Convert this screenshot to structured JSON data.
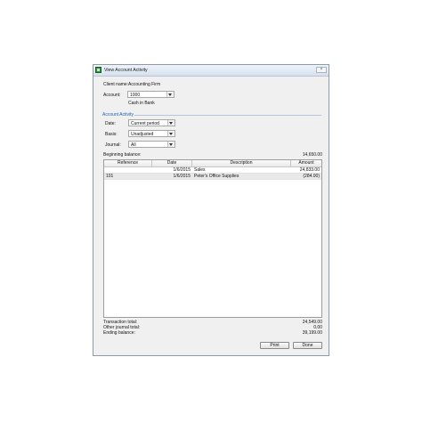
{
  "window": {
    "title": "View Account Activity",
    "close_glyph": "×"
  },
  "client": {
    "label": "Client name:",
    "value": "Accounting Firm"
  },
  "account": {
    "label": "Account:",
    "value": "1000",
    "name": "Cash in Bank"
  },
  "activity": {
    "section_title": "Account Activity",
    "date_label": "Date:",
    "date_value": "Current period",
    "basis_label": "Basis:",
    "basis_value": "Unadjusted",
    "journal_label": "Journal:",
    "journal_value": "All"
  },
  "beginning_balance": {
    "label": "Beginning balance:",
    "value": "14,650.00"
  },
  "table": {
    "headers": [
      "Reference",
      "Date",
      "Description",
      "Amount"
    ],
    "rows": [
      {
        "reference": "",
        "date": "1/6/2015",
        "description": "Sales",
        "amount": "24,833.00"
      },
      {
        "reference": "101",
        "date": "1/6/2015",
        "description": "Peter's Office Supplies",
        "amount": "(284.00)"
      }
    ]
  },
  "totals": {
    "transaction_label": "Transaction total:",
    "transaction_value": "24,549.00",
    "other_label": "Other journal total:",
    "other_value": "0.00",
    "ending_label": "Ending balance:",
    "ending_value": "39,199.00"
  },
  "buttons": {
    "print": "Print",
    "done": "Done"
  }
}
